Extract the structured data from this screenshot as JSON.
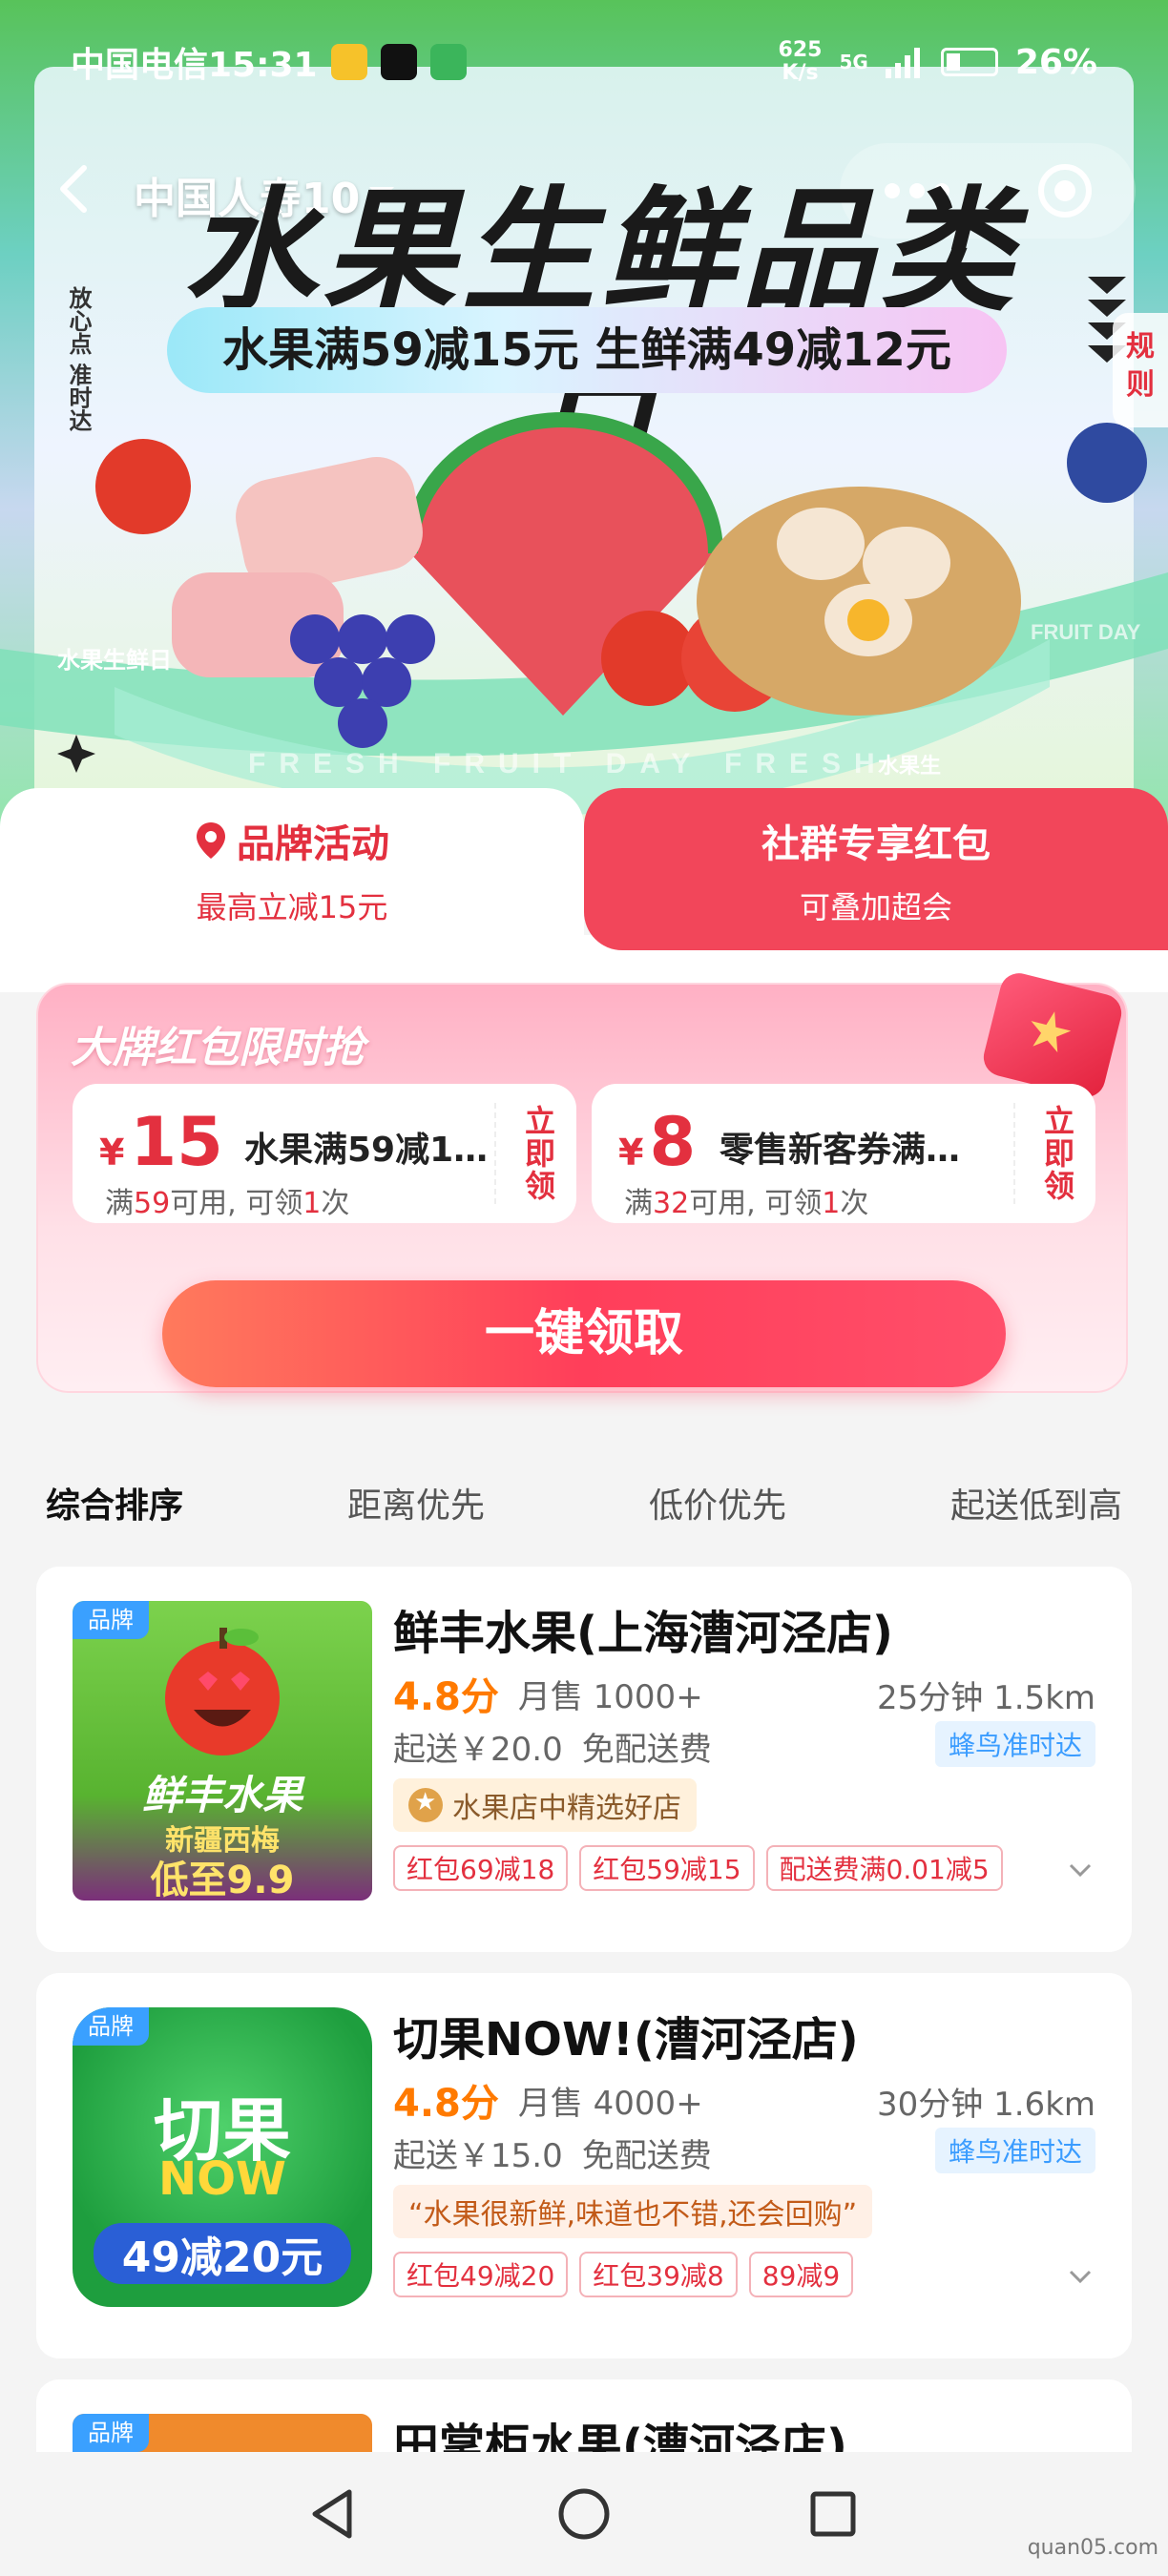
{
  "status_bar": {
    "carrier_time": "中国电信15:31",
    "net_speed_value": "625",
    "net_speed_unit": "K/s",
    "network": "5G",
    "battery": "26%"
  },
  "nav": {
    "store_select": "中国人寿10",
    "rules": "规则"
  },
  "hero": {
    "title": "水果生鲜品类日",
    "subtitle": "水果满59减15元 生鲜满49减12元",
    "side_slogan": "放心点 准时达",
    "ribbon_text": "水果生鲜日",
    "ribbon_text_2": "水果生",
    "ribbon_en": "FRESH FRUIT DAY FRESH",
    "ribbon_en_2": "FRUIT DAY"
  },
  "promo_tabs": {
    "brand": {
      "title": "品牌活动",
      "subtitle": "最高立减15元"
    },
    "group": {
      "title": "社群专享红包",
      "subtitle": "可叠加超会"
    }
  },
  "coupon_panel": {
    "heading": "大牌红包限时抢",
    "coupons": [
      {
        "currency": "¥",
        "amount": "15",
        "name": "水果满59减1...",
        "cond_pre": "满",
        "cond_min": "59",
        "cond_mid": "可用, 可领",
        "cond_count": "1",
        "cond_post": "次",
        "claim": "立即领"
      },
      {
        "currency": "¥",
        "amount": "8",
        "name": "零售新客券满32...",
        "cond_pre": "满",
        "cond_min": "32",
        "cond_mid": "可用, 可领",
        "cond_count": "1",
        "cond_post": "次",
        "claim": "立即领"
      }
    ],
    "claim_all": "一键领取"
  },
  "sort_bar": [
    "综合排序",
    "距离优先",
    "低价优先",
    "起送低到高"
  ],
  "stores": [
    {
      "badge": "品牌",
      "logo_text_1": "鲜丰水果",
      "logo_text_2": "新疆西梅",
      "logo_text_3": "低至9.9",
      "name": "鲜丰水果(上海漕河泾店)",
      "rating": "4.8分",
      "monthly_sales": "月售 1000+",
      "eta": "25分钟  1.5km",
      "min_order": "起送￥20.0",
      "delivery_fee": "免配送费",
      "delivery_tag": "蜂鸟准时达",
      "feature": "水果店中精选好店",
      "promos": [
        "红包69减18",
        "红包59减15",
        "配送费满0.01减5"
      ]
    },
    {
      "badge": "品牌",
      "logo_text_1": "切果",
      "logo_text_2": "NOW",
      "logo_text_3": "49减20元",
      "name": "切果NOW!(漕河泾店)",
      "rating": "4.8分",
      "monthly_sales": "月售 4000+",
      "eta": "30分钟  1.6km",
      "min_order": "起送￥15.0",
      "delivery_fee": "免配送费",
      "delivery_tag": "蜂鸟准时达",
      "feature": "“水果很新鲜,味道也不错,还会回购”",
      "promos": [
        "红包49减20",
        "红包39减8",
        "89减9"
      ]
    },
    {
      "badge": "品牌",
      "name": "田掌柜水果(漕河泾店)"
    }
  ],
  "watermark": "quan05.com",
  "colors": {
    "accent_red": "#e3303f",
    "rating_orange": "#ff7a00",
    "delivery_blue": "#3a9cff"
  }
}
